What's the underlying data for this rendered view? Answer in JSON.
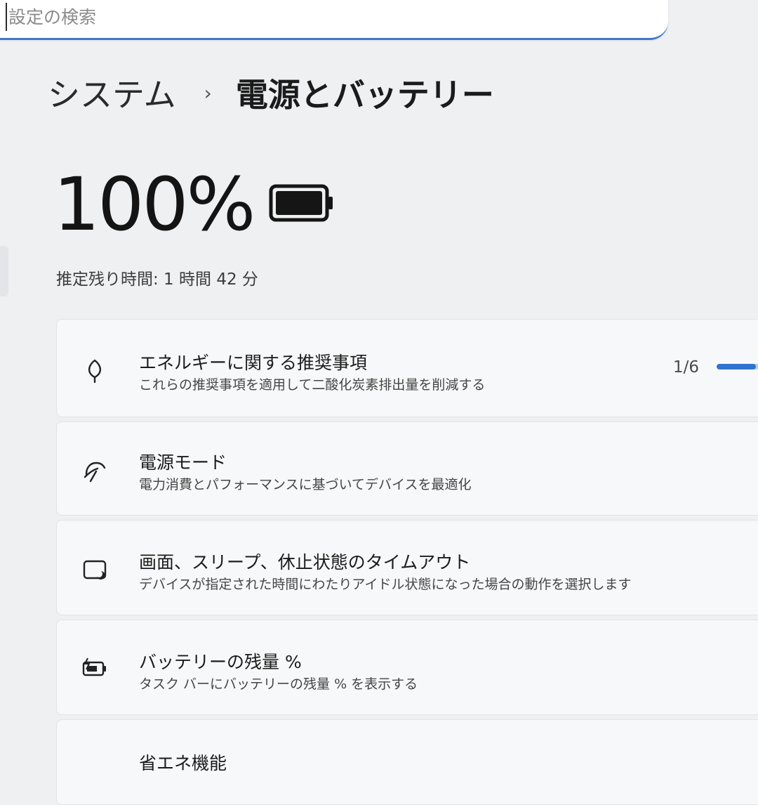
{
  "search": {
    "placeholder": "設定の検索"
  },
  "breadcrumb": {
    "parent": "システム",
    "separator": "›",
    "current": "電源とバッテリー"
  },
  "battery": {
    "percent_text": "100%",
    "level": 1.0,
    "remaining": "推定残り時間: 1 時間 42 分"
  },
  "cards": [
    {
      "icon": "leaf-icon",
      "title": "エネルギーに関する推奨事項",
      "description": "これらの推奨事項を適用して二酸化炭素排出量を削減する",
      "progress_text": "1/6",
      "progress": 0.8
    },
    {
      "icon": "power-mode-icon",
      "title": "電源モード",
      "description": "電力消費とパフォーマンスに基づいてデバイスを最適化"
    },
    {
      "icon": "sleep-timeout-icon",
      "title": "画面、スリープ、休止状態のタイムアウト",
      "description": "デバイスが指定された時間にわたりアイドル状態になった場合の動作を選択します"
    },
    {
      "icon": "battery-percentage-icon",
      "title": "バッテリーの残量 %",
      "description": "タスク バーにバッテリーの残量 % を表示する"
    },
    {
      "icon": "energy-saver-icon",
      "title": "省エネ機能"
    }
  ],
  "colors": {
    "accent": "#2f73d0",
    "background": "#eef0f2",
    "card": "#f7f8f9"
  }
}
